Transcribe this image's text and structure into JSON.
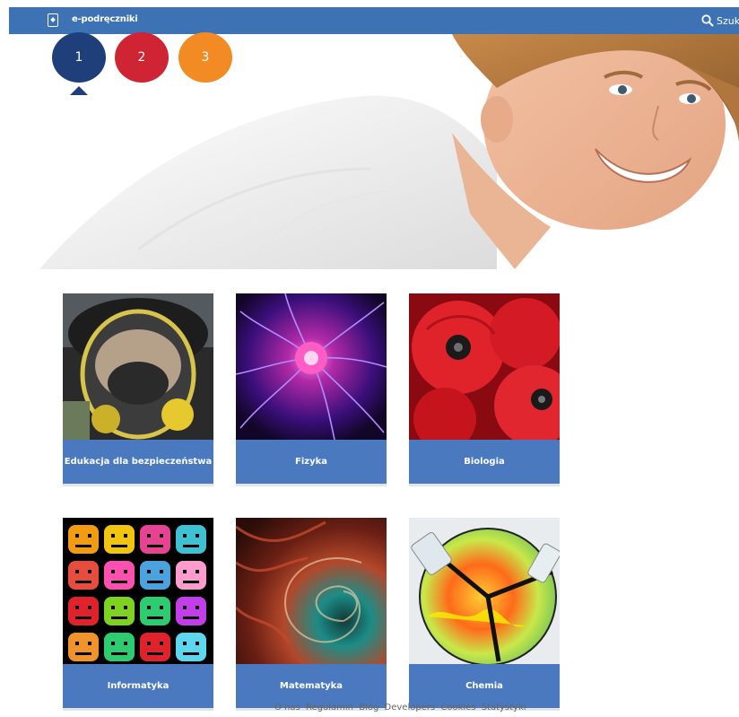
{
  "header": {
    "brand": "e-podręczniki",
    "search_label": "Szuka"
  },
  "hero": {
    "steps": [
      "1",
      "2",
      "3"
    ],
    "active_step": "1"
  },
  "subjects": [
    {
      "label": "Edukacja dla bezpieczeństwa"
    },
    {
      "label": "Fizyka"
    },
    {
      "label": "Biologia"
    },
    {
      "label": "Informatyka"
    },
    {
      "label": "Matematyka"
    },
    {
      "label": "Chemia"
    }
  ],
  "footer": {
    "links": [
      "O nas",
      "Regulamin",
      "Blog",
      "Developers",
      "Cookies",
      "Statystyki"
    ]
  },
  "colors": {
    "topbar": "#3d72b4",
    "tile_label": "#4a79bf",
    "step1": "#1f3f7a",
    "step2": "#cf2433",
    "step3": "#f28b24"
  }
}
